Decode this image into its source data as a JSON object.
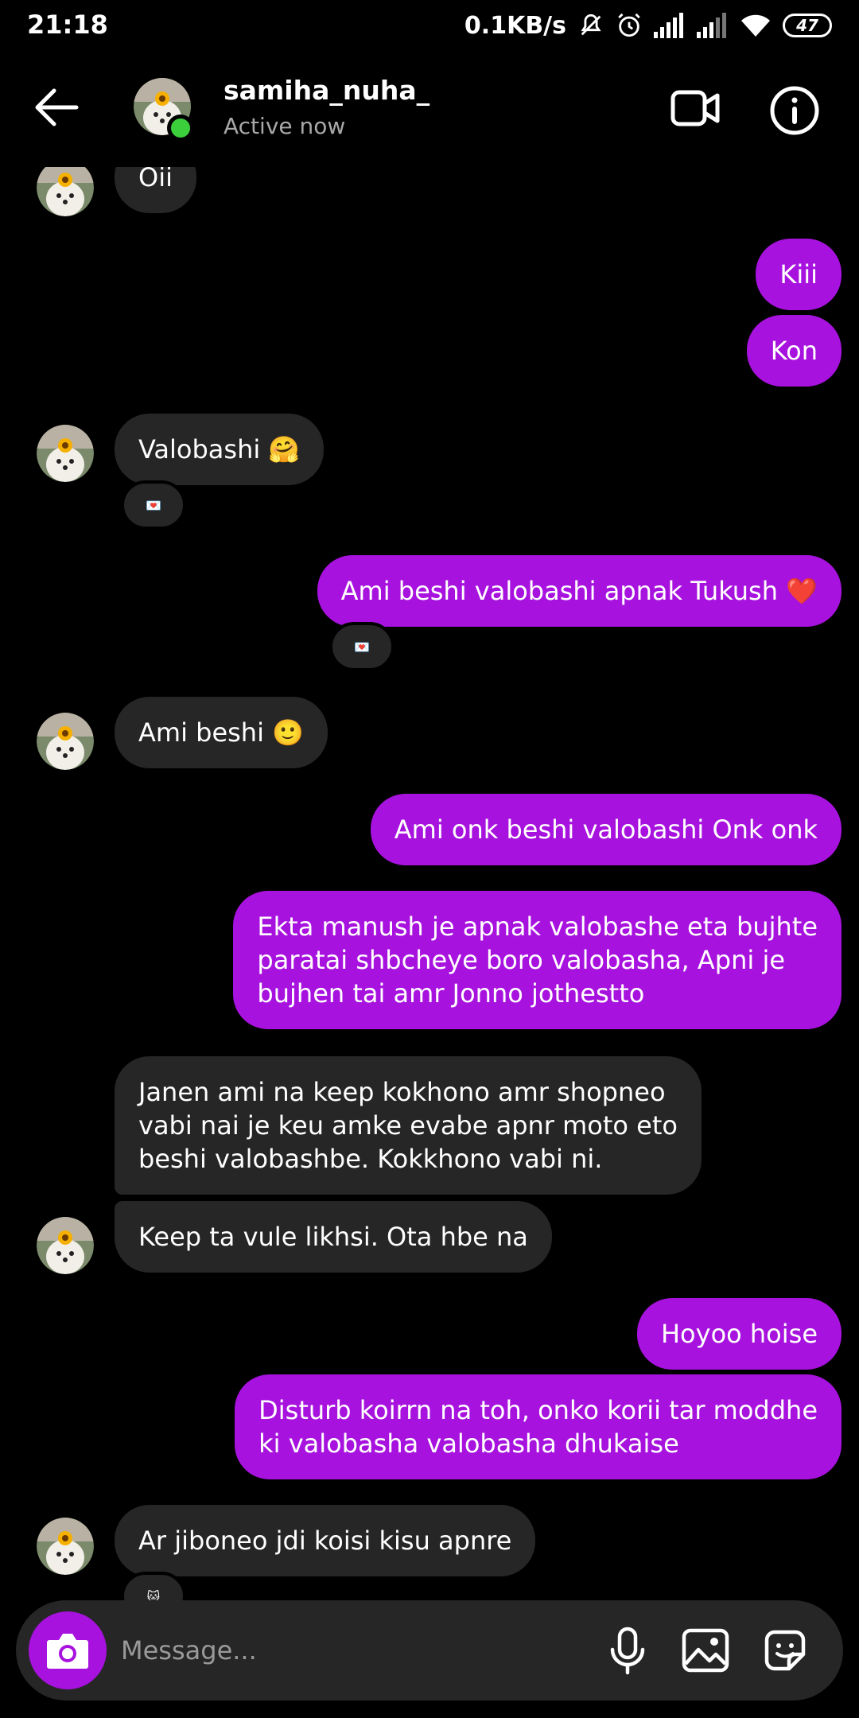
{
  "status_bar": {
    "time": "21:18",
    "net_speed": "0.1KB/s",
    "battery": "47"
  },
  "header": {
    "username": "samiha_nuha_",
    "status": "Active now"
  },
  "messages": [
    {
      "side": "in",
      "text": "Oii"
    },
    {
      "side": "out",
      "text": "Kiii"
    },
    {
      "side": "out",
      "text": "Kon"
    },
    {
      "side": "in",
      "text": "Valobashi 🤗",
      "reaction": "💌"
    },
    {
      "side": "out",
      "text": "Ami beshi valobashi apnak Tukush ❤️",
      "reaction": "💌"
    },
    {
      "side": "in",
      "text": "Ami beshi 🙂"
    },
    {
      "side": "out",
      "text": "Ami onk beshi valobashi Onk onk"
    },
    {
      "side": "out",
      "lines": [
        "Ekta manush je apnak valobashe eta bujhte",
        "paratai  shbcheye boro valobasha, Apni je",
        "bujhen tai amr Jonno jothestto"
      ]
    },
    {
      "side": "in",
      "lines": [
        "Janen ami na keep kokhono amr shopneo",
        "vabi nai je keu amke evabe apnr moto eto",
        "beshi valobashbe. Kokkhono vabi ni."
      ]
    },
    {
      "side": "in",
      "text": "Keep ta vule likhsi. Ota hbe na"
    },
    {
      "side": "out",
      "text": "Hoyoo hoise"
    },
    {
      "side": "out",
      "lines": [
        "Disturb koirrn na toh, onko korii tar moddhe",
        "ki valobasha valobasha dhukaise"
      ]
    },
    {
      "side": "in",
      "text": "Ar jiboneo jdi koisi kisu apnre",
      "reaction": "🐱"
    }
  ],
  "composer": {
    "placeholder": "Message..."
  },
  "colors": {
    "outgoing": "#a712de",
    "incoming": "#262626",
    "background": "#000000",
    "online": "#3ccf3c"
  },
  "icons": [
    "back-arrow-icon",
    "video-call-icon",
    "info-icon",
    "camera-icon",
    "microphone-icon",
    "gallery-icon",
    "sticker-icon"
  ]
}
